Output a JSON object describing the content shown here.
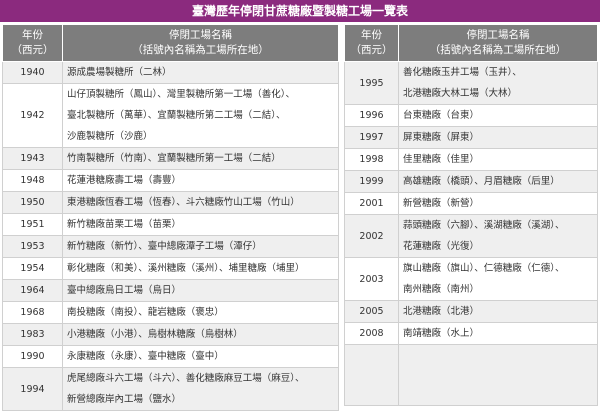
{
  "title": "臺灣歷年停閉甘蔗糖廠暨製糖工場一覽表",
  "header": {
    "year_line1": "年份",
    "year_line2": "（西元）",
    "name_line1": "停閉工場名稱",
    "name_line2": "（括號內名稱為工場所在地）"
  },
  "left_rows": [
    {
      "year": "1940",
      "lines": [
        "源成農場製糖所（二林）"
      ]
    },
    {
      "year": "1942",
      "lines": [
        "山仔頂製糖所（鳳山）、灣里製糖所第一工場（善化）、",
        "臺北製糖所（萬華）、宜蘭製糖所第二工場（二結）、",
        "沙鹿製糖所（沙鹿）"
      ]
    },
    {
      "year": "1943",
      "lines": [
        "竹南製糖所（竹南）、宜蘭製糖所第一工場（二結）"
      ]
    },
    {
      "year": "1948",
      "lines": [
        "花蓮港糖廠壽工場（壽豐）"
      ]
    },
    {
      "year": "1950",
      "lines": [
        "東港糖廠恆春工場（恆春）、斗六糖廠竹山工場（竹山）"
      ]
    },
    {
      "year": "1951",
      "lines": [
        "新竹糖廠苗栗工場（苗栗）"
      ]
    },
    {
      "year": "1953",
      "lines": [
        "新竹糖廠（新竹）、臺中總廠潭子工場（潭仔）"
      ]
    },
    {
      "year": "1954",
      "lines": [
        "彰化糖廠（和美）、溪州糖廠（溪州）、埔里糖廠（埔里）"
      ]
    },
    {
      "year": "1964",
      "lines": [
        "臺中總廠烏日工場（烏日）"
      ]
    },
    {
      "year": "1968",
      "lines": [
        "南投糖廠（南投）、龍岩糖廠（褒忠）"
      ]
    },
    {
      "year": "1983",
      "lines": [
        "小港糖廠（小港）、烏樹林糖廠（烏樹林）"
      ]
    },
    {
      "year": "1990",
      "lines": [
        "永康糖廠（永康）、臺中糖廠（臺中）"
      ]
    },
    {
      "year": "1994",
      "lines": [
        "虎尾總廠斗六工場（斗六）、善化糖廠麻豆工場（麻豆）、",
        "新營總廠岸內工場（鹽水）"
      ]
    }
  ],
  "right_rows": [
    {
      "year": "1995",
      "lines": [
        "善化糖廠玉井工場（玉井）、",
        "北港糖廠大林工場（大林）"
      ]
    },
    {
      "year": "1996",
      "lines": [
        "台東糖廠（台東）"
      ]
    },
    {
      "year": "1997",
      "lines": [
        "屏東糖廠（屏東）"
      ]
    },
    {
      "year": "1998",
      "lines": [
        "佳里糖廠（佳里）"
      ]
    },
    {
      "year": "1999",
      "lines": [
        "高雄糖廠（橋頭）、月眉糖廠（后里）"
      ]
    },
    {
      "year": "2001",
      "lines": [
        "新營糖廠（新營）"
      ]
    },
    {
      "year": "2002",
      "lines": [
        "蒜頭糖廠（六腳）、溪湖糖廠（溪湖）、",
        "花蓮糖廠（光復）"
      ]
    },
    {
      "year": "2003",
      "lines": [
        "旗山糖廠（旗山）、仁德糖廠（仁德）、",
        "南州糖廠（南州）"
      ]
    },
    {
      "year": "2005",
      "lines": [
        "北港糖廠（北港）"
      ]
    },
    {
      "year": "2008",
      "lines": [
        "南靖糖廠（水上）"
      ]
    },
    {
      "year": "",
      "lines": []
    }
  ]
}
